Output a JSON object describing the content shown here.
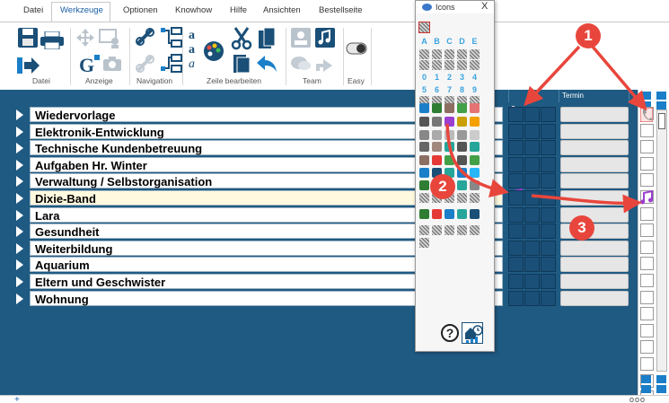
{
  "menu": {
    "tabs": [
      {
        "label": "Datei"
      },
      {
        "label": "Werkzeuge"
      },
      {
        "label": "Optionen"
      },
      {
        "label": "Knowhow"
      },
      {
        "label": "Hilfe"
      },
      {
        "label": "Ansichten"
      },
      {
        "label": "Bestellseite"
      }
    ],
    "active": "Werkzeuge"
  },
  "ribbon": {
    "groups": [
      {
        "label": "Datei"
      },
      {
        "label": "Anzeige"
      },
      {
        "label": "Navigation"
      },
      {
        "label": "Zeile bearbeiten"
      },
      {
        "label": "Team"
      },
      {
        "label": "Easy"
      }
    ]
  },
  "table": {
    "termin_header": "Termin",
    "rows": [
      {
        "label": "Wiedervorlage",
        "highlighted": false
      },
      {
        "label": "Elektronik-Entwicklung",
        "highlighted": false
      },
      {
        "label": "Technische Kundenbetreuung",
        "highlighted": false
      },
      {
        "label": "Aufgaben Hr. Winter",
        "highlighted": false
      },
      {
        "label": "Verwaltung / Selbstorganisation",
        "highlighted": false
      },
      {
        "label": "Dixie-Band",
        "highlighted": true
      },
      {
        "label": "Lara",
        "highlighted": false
      },
      {
        "label": "Gesundheit",
        "highlighted": false
      },
      {
        "label": "Weiterbildung",
        "highlighted": false
      },
      {
        "label": "Aquarium",
        "highlighted": false
      },
      {
        "label": "Eltern und Geschwister",
        "highlighted": false
      },
      {
        "label": "Wohnung",
        "highlighted": false
      }
    ]
  },
  "palette": {
    "title": "Icons",
    "close_glyph": "X",
    "letters": [
      "A",
      "B",
      "C",
      "D",
      "E"
    ],
    "digits_row1": [
      "0",
      "1",
      "2",
      "3",
      "4"
    ],
    "digits_row2": [
      "5",
      "6",
      "7",
      "8",
      "9"
    ],
    "help_glyph": "?"
  },
  "callouts": [
    "1",
    "2",
    "3"
  ],
  "bottom": {
    "plus": "+",
    "icons": "ooo"
  },
  "colors": {
    "main_bg": "#1f5a82",
    "highlight_row": "#fffadf",
    "callout": "#e8463c",
    "accent_blue": "#1a7fc8",
    "note_icon": "#9b3fd0"
  }
}
